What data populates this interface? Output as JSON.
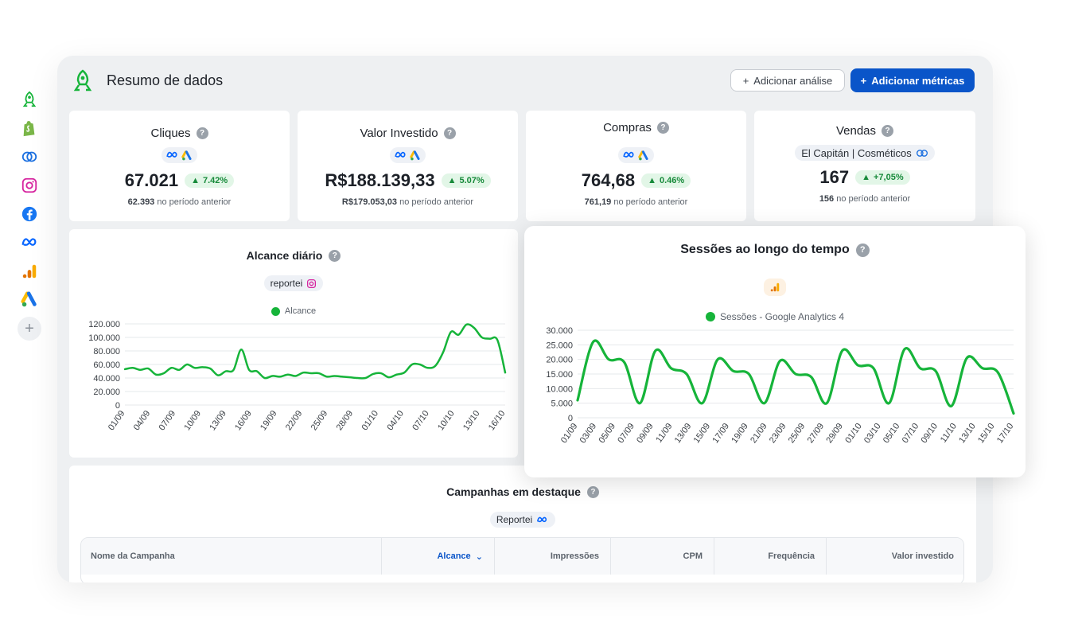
{
  "header": {
    "title": "Resumo de dados",
    "btn_add_analysis": "Adicionar análise",
    "btn_add_metrics": "Adicionar métricas"
  },
  "sidebar_icons": [
    "rocket-icon",
    "shopify-icon",
    "rd-station-icon",
    "instagram-icon",
    "facebook-icon",
    "meta-icon",
    "google-analytics-icon",
    "google-ads-icon",
    "plus-icon"
  ],
  "kpis": [
    {
      "title": "Cliques",
      "value": "67.021",
      "delta": "7.42%",
      "prev_value": "62.393",
      "prev_label": "no período anterior"
    },
    {
      "title": "Valor Investido",
      "value": "R$188.139,33",
      "delta": "5.07%",
      "prev_value": "R$179.053,03",
      "prev_label": "no período anterior"
    },
    {
      "title": "Compras",
      "value": "764,68",
      "delta": "0.46%",
      "prev_value": "761,19",
      "prev_label": "no período anterior"
    },
    {
      "title": "Vendas",
      "account": "El Capitán | Cosméticos",
      "value": "167",
      "delta": "+7,05%",
      "prev_value": "156",
      "prev_label": "no período anterior"
    }
  ],
  "alcance_card": {
    "title": "Alcance diário",
    "source": "reportei"
  },
  "sessions_card": {
    "title": "Sessões ao longo do tempo"
  },
  "table": {
    "title": "Campanhas em destaque",
    "source": "Reportei",
    "columns": [
      "Nome da Campanha",
      "Alcance",
      "Impressões",
      "CPM",
      "Frequência",
      "Valor investido"
    ]
  },
  "colors": {
    "accent_green": "#16b43a",
    "primary_blue": "#0a55c9",
    "badge_green_bg": "#e2f6e7"
  },
  "chart_data": [
    {
      "type": "line",
      "series": [
        {
          "name": "Alcance",
          "values": [
            53000,
            55000,
            52000,
            54000,
            45000,
            47000,
            55000,
            52000,
            60000,
            55000,
            56000,
            54000,
            44000,
            50000,
            52000,
            82000,
            52000,
            50000,
            40000,
            43000,
            42000,
            45000,
            43000,
            48000,
            47000,
            47000,
            42000,
            43000,
            42000,
            41000,
            40000,
            40000,
            46000,
            47000,
            41000,
            45000,
            48000,
            60000,
            60000,
            55000,
            58000,
            78000,
            108000,
            104000,
            119000,
            114000,
            100000,
            98000,
            96000,
            48000
          ]
        }
      ],
      "x_ticks": [
        "01/09",
        "04/09",
        "07/09",
        "10/09",
        "13/09",
        "16/09",
        "19/09",
        "22/09",
        "25/09",
        "28/09",
        "01/10",
        "04/10",
        "07/10",
        "10/10",
        "13/10",
        "16/10"
      ],
      "y_ticks": [
        "120.000",
        "100.000",
        "80.000",
        "60.000",
        "40.000",
        "20.000",
        "0"
      ],
      "ylim": [
        0,
        120000
      ]
    },
    {
      "type": "line",
      "series": [
        {
          "name": "Sessões - Google Analytics 4",
          "values": [
            6000,
            26000,
            20000,
            19000,
            5000,
            23000,
            17000,
            15000,
            5000,
            20000,
            16000,
            15000,
            5000,
            19500,
            15000,
            14000,
            5000,
            23000,
            18000,
            17000,
            5000,
            23500,
            17000,
            16000,
            4000,
            20500,
            17000,
            15500,
            1500
          ]
        }
      ],
      "x_ticks": [
        "01/09",
        "03/09",
        "05/09",
        "07/09",
        "09/09",
        "11/09",
        "13/09",
        "15/09",
        "17/09",
        "19/09",
        "21/09",
        "23/09",
        "25/09",
        "27/09",
        "29/09",
        "01/10",
        "03/10",
        "05/10",
        "07/10",
        "09/10",
        "11/10",
        "13/10",
        "15/10",
        "17/10"
      ],
      "y_ticks": [
        "30.000",
        "25.000",
        "20.000",
        "15.000",
        "10.000",
        "5.000",
        "0"
      ],
      "ylim": [
        0,
        30000
      ]
    }
  ]
}
